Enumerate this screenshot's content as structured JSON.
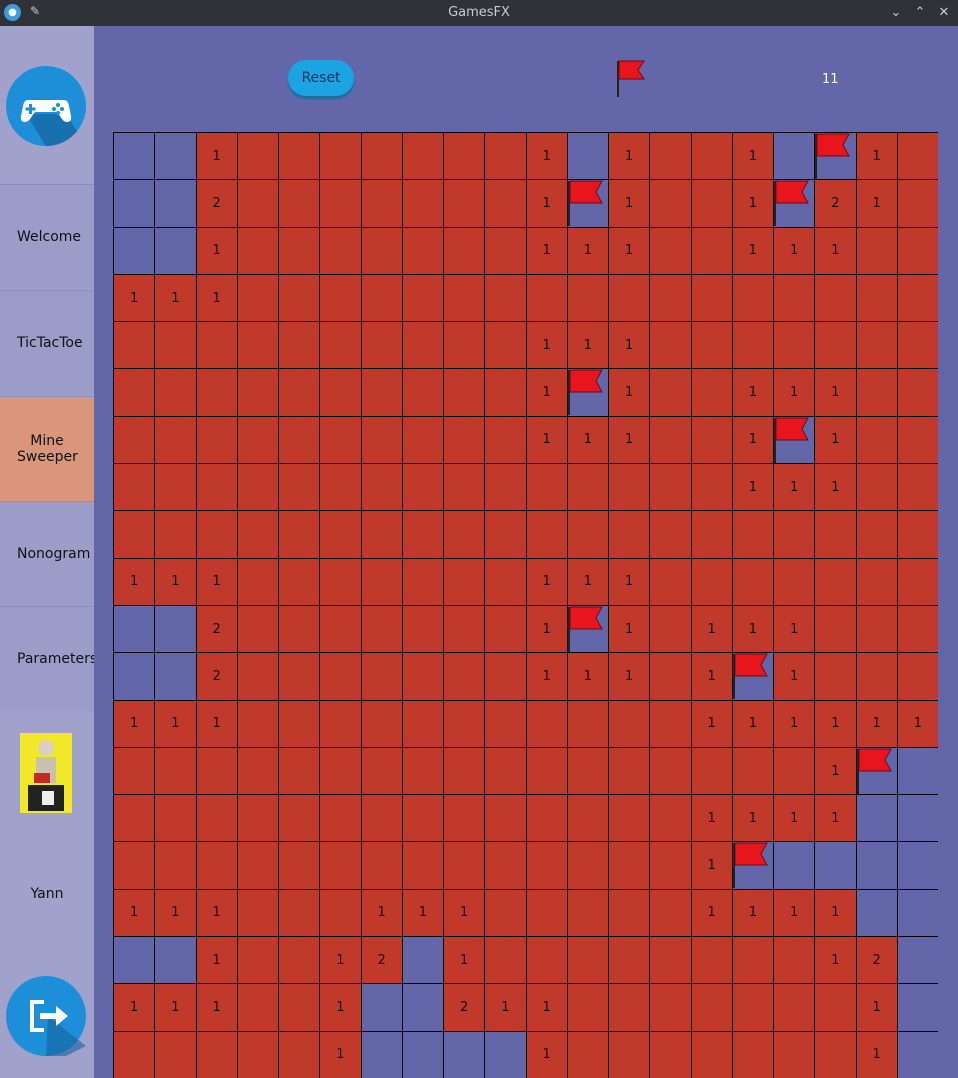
{
  "window": {
    "title": "GamesFX"
  },
  "sidebar": {
    "items": [
      {
        "label": "Welcome",
        "active": false
      },
      {
        "label": "TicTacToe",
        "active": false
      },
      {
        "label": "Mine Sweeper",
        "active": true
      },
      {
        "label": "Nonogram",
        "active": false
      },
      {
        "label": "Parameters",
        "active": false
      }
    ],
    "user_name": "Yann"
  },
  "toolbar": {
    "reset_label": "Reset",
    "flags_remaining": "11"
  },
  "colors": {
    "closed": "#c0392b",
    "open": "#6466aa",
    "flag": "#e8161c",
    "accent": "#1d8fd8"
  },
  "board": {
    "legend": "O = revealed empty, R = unrevealed, F = flag, digit = revealed number",
    "rows": [
      "OO1RRRRRRR1O1RR1OF1R",
      "OO2RRRRRRR1F1RR1F21R",
      "OO1RRRRRRR111RR111RR",
      "111RRRRRRRRRRRRRRRRR",
      "RRRRRRRRRR111RRRRRRR",
      "RRRRRRRRRR1F1RR111RR",
      "RRRRRRRRRR111RR1F1RR",
      "RRRRRRRRRRRRRRR111RR",
      "RRRRRRRRRRRRRRRRRRRR",
      "111RRRRRRR111RRRRRRR",
      "OO2RRRRRRR1F1R111RRR",
      "OO2RRRRRRR111R1F1RRR",
      "111RRRRRRRRRRR111111",
      "RRRRRRRRRRRRRRRRR1FO",
      "RRRRRRRRRRRRRR1111OO",
      "RRRRRRRRRRRRRR1FOOOO",
      "111RRR111RRRRR1111OO",
      "OO1RR12O1RRRRRRRR12O",
      "111RR1OO211RRRRRRR1O",
      "RRRRR1OOOO1RRRRRRR1O"
    ]
  }
}
